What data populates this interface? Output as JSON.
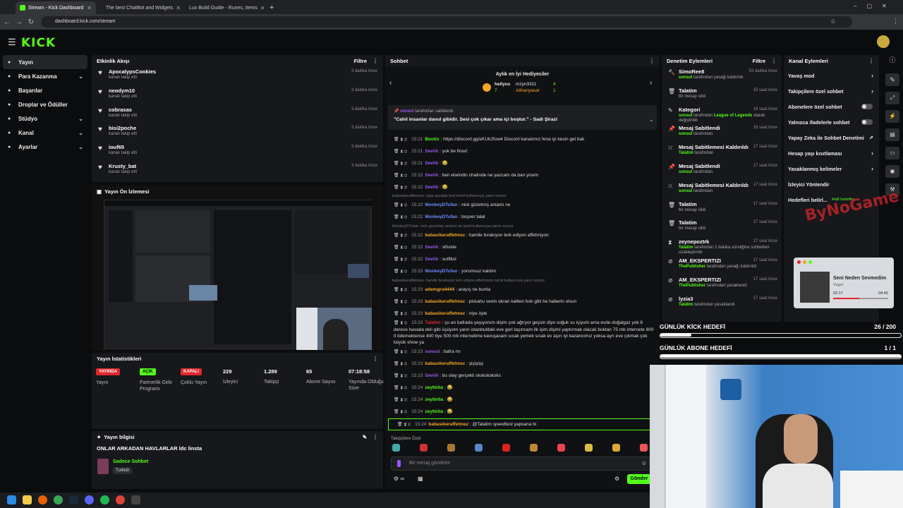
{
  "browser": {
    "tabs": [
      {
        "title": "Stream - Kick Dashboard",
        "active": true
      },
      {
        "title": "The best ChatBot and Widgets",
        "active": false
      },
      {
        "title": "Lux Build Guide - Runes, Items",
        "active": false
      }
    ],
    "url": "dashboard.kick.com/stream",
    "new_tab": "+"
  },
  "brand": {
    "logo": "KICK",
    "accent": "#53fc18"
  },
  "sidebar": {
    "items": [
      {
        "label": "Yayın",
        "icon": "broadcast-icon",
        "active": true
      },
      {
        "label": "Para Kazanma",
        "icon": "money-icon",
        "expandable": true
      },
      {
        "label": "Başarılar",
        "icon": "trophy-icon"
      },
      {
        "label": "Droplar ve Ödüller",
        "icon": "gift-icon"
      },
      {
        "label": "Stüdyo",
        "icon": "studio-icon",
        "expandable": true
      },
      {
        "label": "Kanal",
        "icon": "channel-icon",
        "expandable": true
      },
      {
        "label": "Ayarlar",
        "icon": "gear-icon",
        "expandable": true
      }
    ]
  },
  "activity": {
    "title": "Etkinlik Akışı",
    "filter": "Filtre",
    "items": [
      {
        "name": "ApocalypsCookies",
        "sub": "kanalı takip etti",
        "time": "3 dakika önce"
      },
      {
        "name": "neodym10",
        "sub": "kanalı takip etti",
        "time": "3 dakika önce"
      },
      {
        "name": "cobrasas",
        "sub": "kanalı takip etti",
        "time": "3 dakika önce"
      },
      {
        "name": "bisi2poche",
        "sub": "kanalı takip etti",
        "time": "3 dakika önce"
      },
      {
        "name": "iouf65",
        "sub": "kanalı takip etti",
        "time": "3 dakika önce"
      },
      {
        "name": "Krusty_bat",
        "sub": "kanalı takip etti",
        "time": "3 dakika önce"
      }
    ]
  },
  "preview": {
    "title": "Yayın Ön İzlemesi"
  },
  "stats": {
    "title": "Yayın İstatistikleri",
    "items": [
      {
        "badge": "YAYINDA",
        "badge_color": "#e0272d",
        "label": "Yayın"
      },
      {
        "badge": "AÇIK",
        "badge_color": "#53fc18",
        "label": "Partnerlik Gelir Programı"
      },
      {
        "badge": "KAPALI",
        "badge_color": "#e0272d",
        "label": "Çoklu Yayın"
      },
      {
        "value": "229",
        "label": "İzleyici"
      },
      {
        "value": "1.289",
        "label": "Takipçi"
      },
      {
        "value": "65",
        "label": "Abone Sayısı"
      },
      {
        "value": "07:18:58",
        "label": "Yayında Olduğu Süre"
      }
    ]
  },
  "streaminfo": {
    "title": "Yayın bilgisi",
    "stream_title": "ONLAR ARKADAN HAVLARLAR ldc linsta",
    "category": "Sadece Sohbet",
    "tag": "Turkish"
  },
  "chat": {
    "title": "Sohbet",
    "gifters_title": "Aylık en İyi Hediyeciler",
    "gifters": [
      {
        "name": "heilyus",
        "count": "7"
      },
      {
        "name": "mzyn3311",
        "count": "4"
      },
      {
        "name": "Alihanyasar",
        "count": "1"
      }
    ],
    "pinned": {
      "by": "sonsul",
      "by_suffix": "tarafından sabitlendi",
      "text": "\"Cahil insanlar davul gibidir. Sesi çok çıkar ama içi boştur.\" - Sadi Şirazi"
    },
    "messages": [
      {
        "type": "msg",
        "time": "15:21",
        "name": "Bootix",
        "color": "#53fc18",
        "text": "https://discord.gg/eKUk2fow4 Discord kanalımız fena iyi kesin gel bak"
      },
      {
        "type": "msg",
        "time": "15:21",
        "name": "Seviiii",
        "color": "#9b59f7",
        "text": "yok be flood"
      },
      {
        "type": "msg",
        "time": "15:21",
        "name": "Seviiii",
        "color": "#9b59f7",
        "text": "😂"
      },
      {
        "type": "msg",
        "time": "15:22",
        "name": "Seviiii",
        "color": "#9b59f7",
        "text": "ben elwindin chatinde ne yazcam da ban yicem"
      },
      {
        "type": "msg",
        "time": "15:22",
        "name": "Seviiii",
        "color": "#9b59f7",
        "text": "😂"
      },
      {
        "type": "sys",
        "text": "babasikeraffetmez: şişiş ayvalalı kral isimli kullanıcıya yanıt veriyor"
      },
      {
        "type": "msg",
        "time": "15:22",
        "name": "MonkeyDTufan",
        "color": "#6b8cff",
        "text": "nick güzelmiş anlamı ne"
      },
      {
        "type": "msg",
        "time": "15:22",
        "name": "MonkeyDTufan",
        "color": "#6b8cff",
        "text": "boşver talat"
      },
      {
        "type": "sys",
        "text": "MonkeyDTufan: nick güzelmiş anlamı ne isimli kullanıcıya yanıt veriyor"
      },
      {
        "type": "msg",
        "time": "15:22",
        "name": "babasikeraffetmez",
        "color": "#f5a623",
        "text": "hamile bırakıyon terk ediyon affetmiyon"
      },
      {
        "type": "msg",
        "time": "15:22",
        "name": "Seviiii",
        "color": "#9b59f7",
        "text": "stfuixle"
      },
      {
        "type": "msg",
        "time": "15:22",
        "name": "Seviiii",
        "color": "#9b59f7",
        "text": "sutfiksl"
      },
      {
        "type": "msg",
        "time": "15:23",
        "name": "MonkeyDTufan",
        "color": "#6b8cff",
        "text": "yorumsuz kaldım"
      },
      {
        "type": "sys",
        "text": "babasikeraffetmez: hamile bırakıyon terk ediyon affetmiyon isimli kullanıcıya yanıt veriyor"
      },
      {
        "type": "msg",
        "time": "15:23",
        "name": "ademgro4444",
        "color": "#f5a623",
        "text": "arayış ne burda"
      },
      {
        "type": "msg",
        "time": "15:23",
        "name": "babasikeraffetmez",
        "color": "#f5a623",
        "text": "pickahu senin ekran kaliten bok gibi he haberin olsun"
      },
      {
        "type": "msg",
        "time": "15:23",
        "name": "babasikeraffetmez",
        "color": "#f5a623",
        "text": "niye öyle"
      },
      {
        "type": "long",
        "time": "15:23",
        "name": "Talatim",
        "color": "#e0272d",
        "text": "şu an bafrada yaşıyorum dişim çok ağrıyor geçsin diye soğuk su içiyom ama evde doğalgaz yok 8 derece havada deli gibi üşüyom yarın istanbuldaki eve geri taşıncam ilk işim dişimi yaptırmak olacak boktan 75 mb internete 800 tl ödemektense 400 tlye 500 mb internetime kavuşacam sıcak yemek sıcak ev aşırı iyi kazancımız yoksa ayrı eve çıkmak çok büyük show ya"
      },
      {
        "type": "msg",
        "time": "15:23",
        "name": "sonsul",
        "color": "#9b59f7",
        "text": "bafra mı"
      },
      {
        "type": "msg",
        "time": "15:23",
        "name": "babasikeraffetmez",
        "color": "#f5a623",
        "text": "şişişişş"
      },
      {
        "type": "msg",
        "time": "15:23",
        "name": "Seviiii",
        "color": "#9b59f7",
        "text": "bu olay gerçekti sksksksksks"
      },
      {
        "type": "msg",
        "time": "15:24",
        "name": "zeytinlia",
        "color": "#53fc18",
        "text": "😂"
      },
      {
        "type": "msg",
        "time": "15:24",
        "name": "zeytinlia",
        "color": "#53fc18",
        "text": "😂"
      },
      {
        "type": "msg",
        "time": "15:24",
        "name": "zeytinlia",
        "color": "#53fc18",
        "text": "😂"
      },
      {
        "type": "hl",
        "time": "15:24",
        "name": "babasikeraffetmez",
        "color": "#f5a623",
        "text": "@Talatim speedtest yapsana bi"
      }
    ],
    "followers_only": "Takipçilere Özel",
    "input_placeholder": "Bir mesaj gönderin",
    "send": "Gönder"
  },
  "moderation": {
    "title": "Denetim Eylemleri",
    "filter": "Filtre",
    "items": [
      {
        "icon": "hammer-icon",
        "title": "SimoRee8",
        "line": [
          {
            "b": "sonsul"
          },
          {
            "t": " tarafından yasağı kaldırıldı"
          }
        ],
        "time": "53 dakika önce"
      },
      {
        "icon": "trash-icon",
        "title": "Talatim",
        "line": [
          {
            "t": "bir mesajı sildi"
          }
        ],
        "time": "15 saat önce"
      },
      {
        "icon": "edit-icon",
        "title": "Kategori",
        "line": [
          {
            "b": "sonsul"
          },
          {
            "t": " tarafından "
          },
          {
            "b": "League of Legends"
          },
          {
            "t": " olarak değiştirildi"
          }
        ],
        "time": "16 saat önce"
      },
      {
        "icon": "pin-icon",
        "title": "Mesaj Sabitlendi",
        "line": [
          {
            "b": "sonsul"
          },
          {
            "t": " tarafından"
          }
        ],
        "time": "16 saat önce"
      },
      {
        "icon": "unpin-icon",
        "title": "Mesaj Sabitlemesi Kaldırıldı",
        "line": [
          {
            "b": "Talatim"
          },
          {
            "t": " tarafından"
          }
        ],
        "time": "17 saat önce"
      },
      {
        "icon": "pin-icon",
        "title": "Mesaj Sabitlendi",
        "line": [
          {
            "b": "sonsul"
          },
          {
            "t": " tarafından"
          }
        ],
        "time": "17 saat önce"
      },
      {
        "icon": "unpin-icon",
        "title": "Mesaj Sabitlemesi Kaldırıldı",
        "line": [
          {
            "b": "sonsul"
          },
          {
            "t": " tarafından"
          }
        ],
        "time": "17 saat önce"
      },
      {
        "icon": "trash-icon",
        "title": "Talatim",
        "line": [
          {
            "t": "bir mesajı sildi"
          }
        ],
        "time": "17 saat önce"
      },
      {
        "icon": "trash-icon",
        "title": "Talatim",
        "line": [
          {
            "t": "bir mesajı sildi"
          }
        ],
        "time": "17 saat önce"
      },
      {
        "icon": "timeout-icon",
        "title": "zeynepoztrk",
        "line": [
          {
            "b": "Talatim"
          },
          {
            "t": " tarafından 2 dakika süreliğine sohbetten uzaklaştırıldı"
          }
        ],
        "time": "17 saat önce"
      },
      {
        "icon": "ban-icon",
        "title": "AM_EKSPERTIZI",
        "line": [
          {
            "b": "ThePublisher"
          },
          {
            "t": " tarafından yasağı kaldırıldı"
          }
        ],
        "time": "17 saat önce"
      },
      {
        "icon": "ban-icon",
        "title": "AM_EKSPERTIZI",
        "line": [
          {
            "b": "ThePublisher"
          },
          {
            "t": " tarafından yasaklandı"
          }
        ],
        "time": "17 saat önce"
      },
      {
        "icon": "ban-icon",
        "title": "lyzia3",
        "line": [
          {
            "b": "Talatim"
          },
          {
            "t": " tarafından yasaklandı"
          }
        ],
        "time": "17 saat önce"
      }
    ]
  },
  "channel_actions": {
    "title": "Kanal Eylemleri",
    "items": [
      {
        "label": "Yavaş mod",
        "ctrl": "arrow"
      },
      {
        "label": "Takipçilere özel sohbet",
        "ctrl": "arrow"
      },
      {
        "label": "Abonelere özel sohbet",
        "ctrl": "toggle"
      },
      {
        "label": "Yalnızca ifadelerle sohbet",
        "ctrl": "toggle"
      },
      {
        "label": "Yapay Zeka ile Sohbet Denetimi",
        "ctrl": "ext"
      },
      {
        "label": "Hesap yaşı kısıtlaması",
        "ctrl": "arrow"
      },
      {
        "label": "Yasaklanmış kelimeler",
        "ctrl": "arrow"
      },
      {
        "label": "İzleyici Yönlendir",
        "ctrl": "none"
      },
      {
        "label": "Hedefleri belirl...",
        "ctrl": "none",
        "extra": "Aktif hedefler"
      }
    ]
  },
  "overlay": {
    "watermark": "ByNoGame",
    "music_title": "Seni Neden Sevmedim",
    "music_artist": "Vugor",
    "music_elapsed": "02:17",
    "music_total": "04:45",
    "music_progress": 0.48
  },
  "goals": [
    {
      "label": "GÜNLÜK KİCK HEDEFİ",
      "value": "26 / 200",
      "progress": 0.13
    },
    {
      "label": "GÜNLÜK ABONE HEDEFİ",
      "value": "1 / 1",
      "progress": 1.0
    }
  ]
}
